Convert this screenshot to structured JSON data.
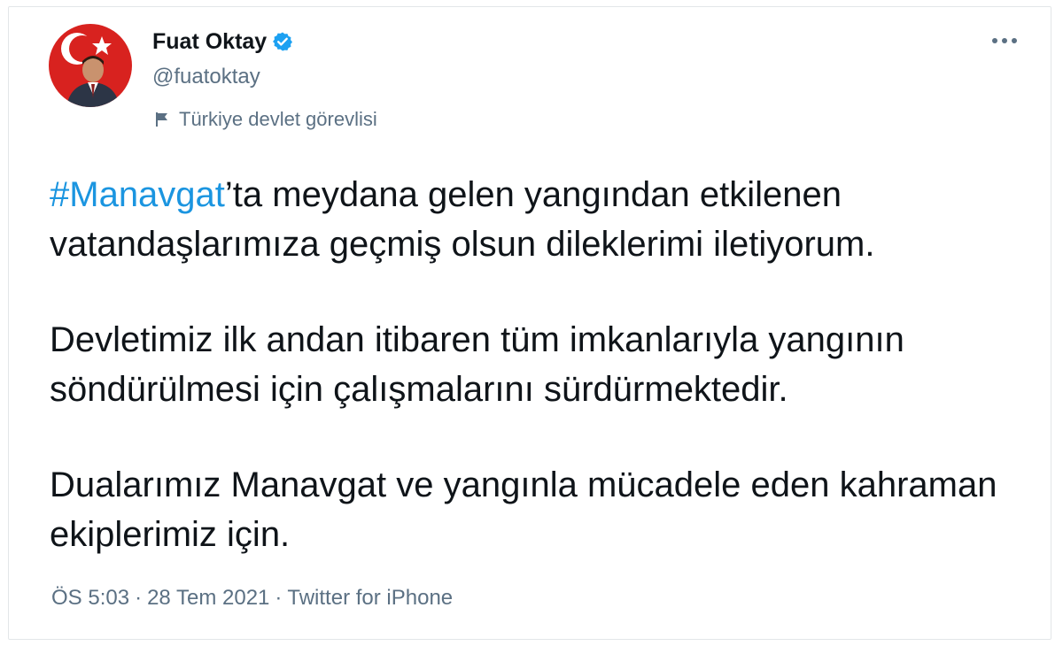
{
  "tweet": {
    "author": {
      "name": "Fuat Oktay",
      "handle": "@fuatoktay",
      "affiliation": "Türkiye devlet görevlisi",
      "verified_icon": "verified-badge-icon",
      "flag_icon": "flag-icon"
    },
    "more_icon": "more-options-icon",
    "paragraphs": [
      {
        "hashtag": "#Manavgat",
        "text": "’ta meydana gelen yangından etkilenen vatandaşlarımıza geçmiş olsun dileklerimi iletiyorum."
      },
      {
        "text": "Devletimiz ilk andan itibaren tüm imkanlarıyla yangının söndürülmesi için çalışmalarını sürdürmektedir."
      },
      {
        "text": "Dualarımız Manavgat ve yangınla mücadele eden kahraman ekiplerimiz için."
      }
    ],
    "meta": {
      "time": "ÖS 5:03",
      "separator": "·",
      "date": "28 Tem 2021",
      "source": "Twitter for iPhone"
    }
  },
  "colors": {
    "accent": "#1b95e0",
    "verified": "#1da1f2",
    "text_primary": "#0f1419",
    "text_secondary": "#5b7083",
    "avatar_red": "#d8221f"
  }
}
